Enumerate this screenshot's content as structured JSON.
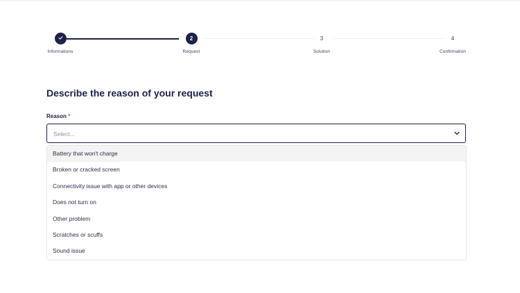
{
  "stepper": {
    "steps": [
      {
        "number": "✓",
        "label": "Informations",
        "state": "completed"
      },
      {
        "number": "2",
        "label": "Request",
        "state": "active"
      },
      {
        "number": "3",
        "label": "Solution",
        "state": "pending"
      },
      {
        "number": "4",
        "label": "Confirmation",
        "state": "pending"
      }
    ]
  },
  "main": {
    "title": "Describe the reason of your request",
    "reason_field": {
      "label": "Reason",
      "required_marker": "*",
      "placeholder": "Select..."
    },
    "options": [
      "Battery that won't charge",
      "Broken or cracked screen",
      "Connectivity issue with app or other devices",
      "Does not turn on",
      "Other problem",
      "Scratches or scuffs",
      "Sound issue"
    ],
    "highlighted_option_index": 0
  },
  "colors": {
    "primary": "#1b2147",
    "required": "#d83b3b",
    "highlight": "#f4f4f5"
  },
  "icons": {
    "completed_step": "check-icon",
    "dropdown": "chevron-down-icon"
  }
}
